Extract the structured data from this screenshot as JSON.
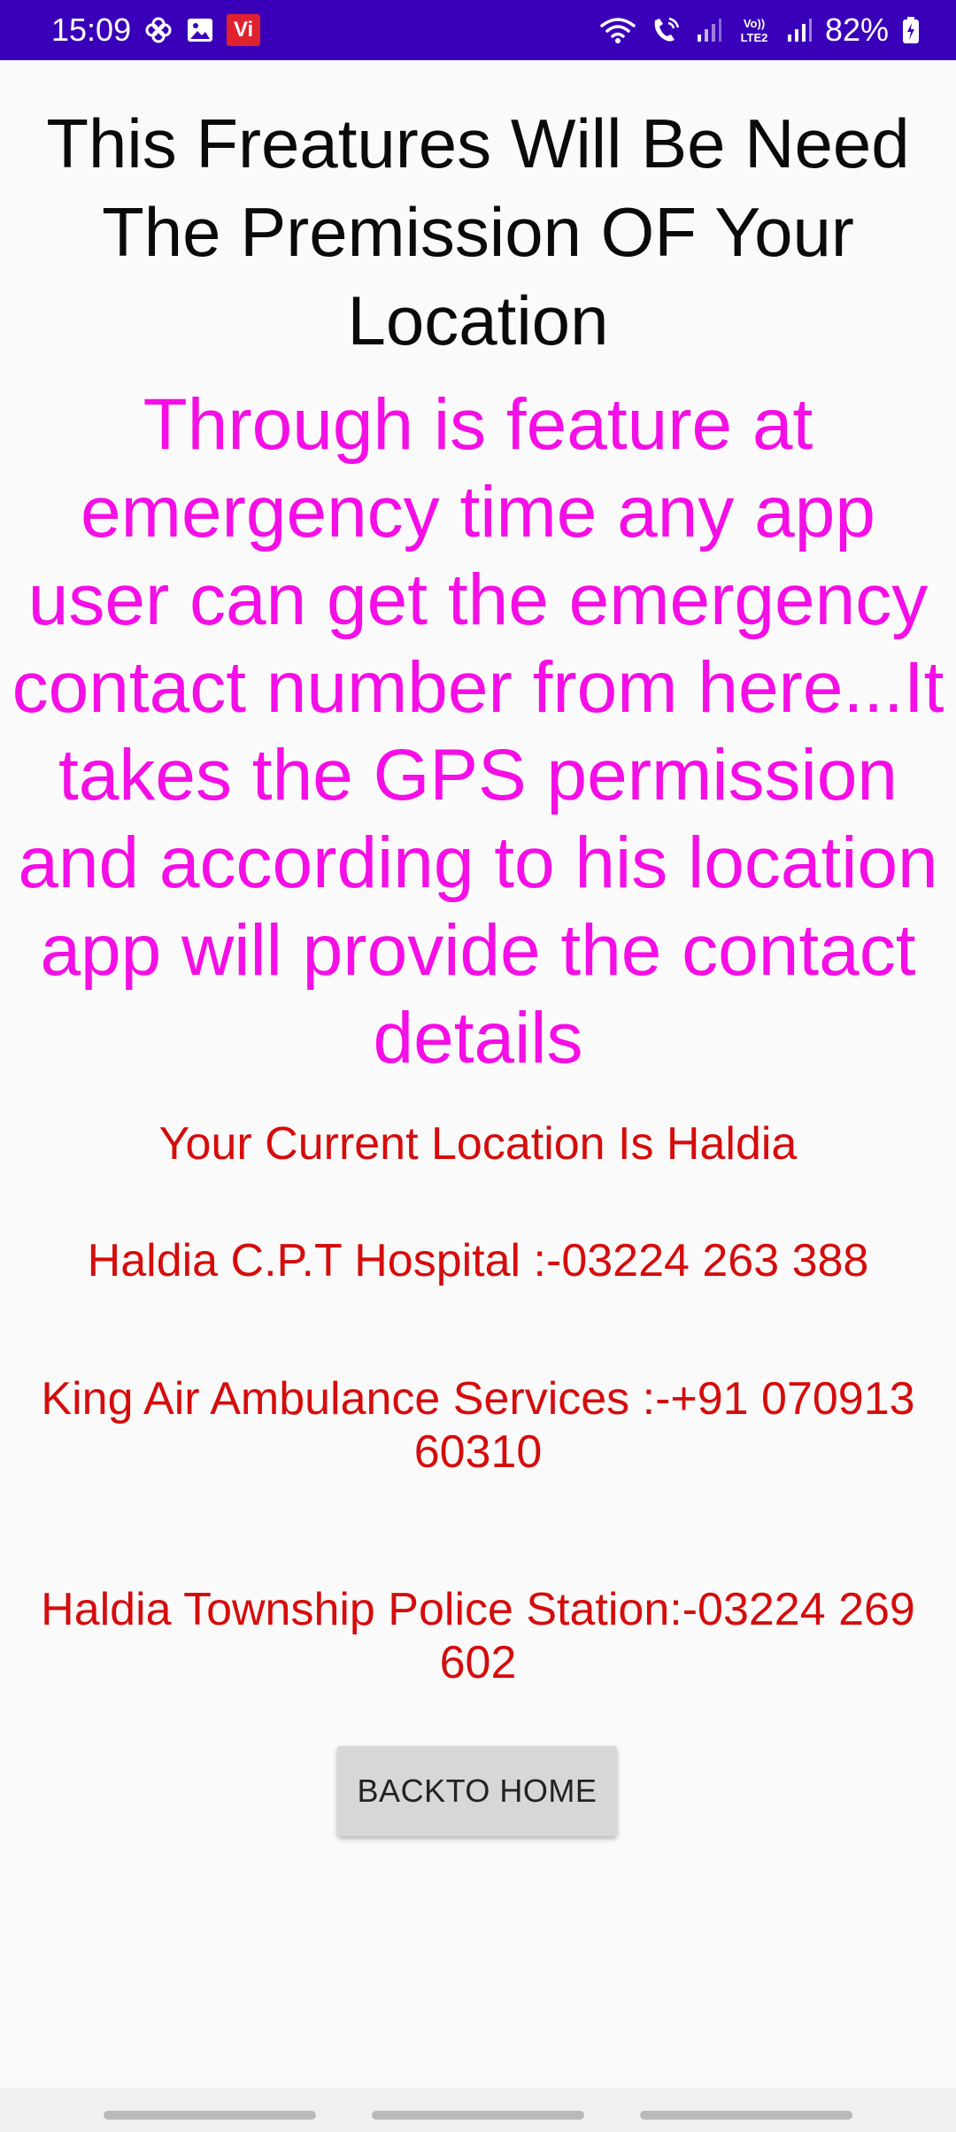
{
  "status_bar": {
    "time": "15:09",
    "carrier_badge": "Vi",
    "battery": "82%",
    "left_icons": [
      "pinwheel-icon",
      "gallery-icon"
    ],
    "right_icons": [
      "wifi-icon",
      "wifi-calling-icon",
      "signal-icon",
      "volte-icon",
      "signal-icon",
      "battery-icon"
    ],
    "volte_label": "Vo)) LTE2",
    "background_color": "#3a00b9"
  },
  "main": {
    "title": "This Freatures Will Be Need The Premission OF Your Location",
    "description": "Through is feature at emergency time any app user can get the emergency contact number from here...It takes the GPS permission and according to his location app will provide the contact details",
    "current_location": "Your Current Location Is Haldia",
    "contacts": [
      "Haldia C.P.T Hospital :-03224 263 388",
      "King Air Ambulance Services :-+91 070913 60310",
      "Haldia Township Police Station:-03224 269 602"
    ],
    "back_button_label": "BACKTO HOME"
  },
  "colors": {
    "description_text": "#f50ee5",
    "contact_text": "#d50c0c",
    "title_text": "#0a0a0a",
    "button_bg": "#d6d7d7"
  }
}
